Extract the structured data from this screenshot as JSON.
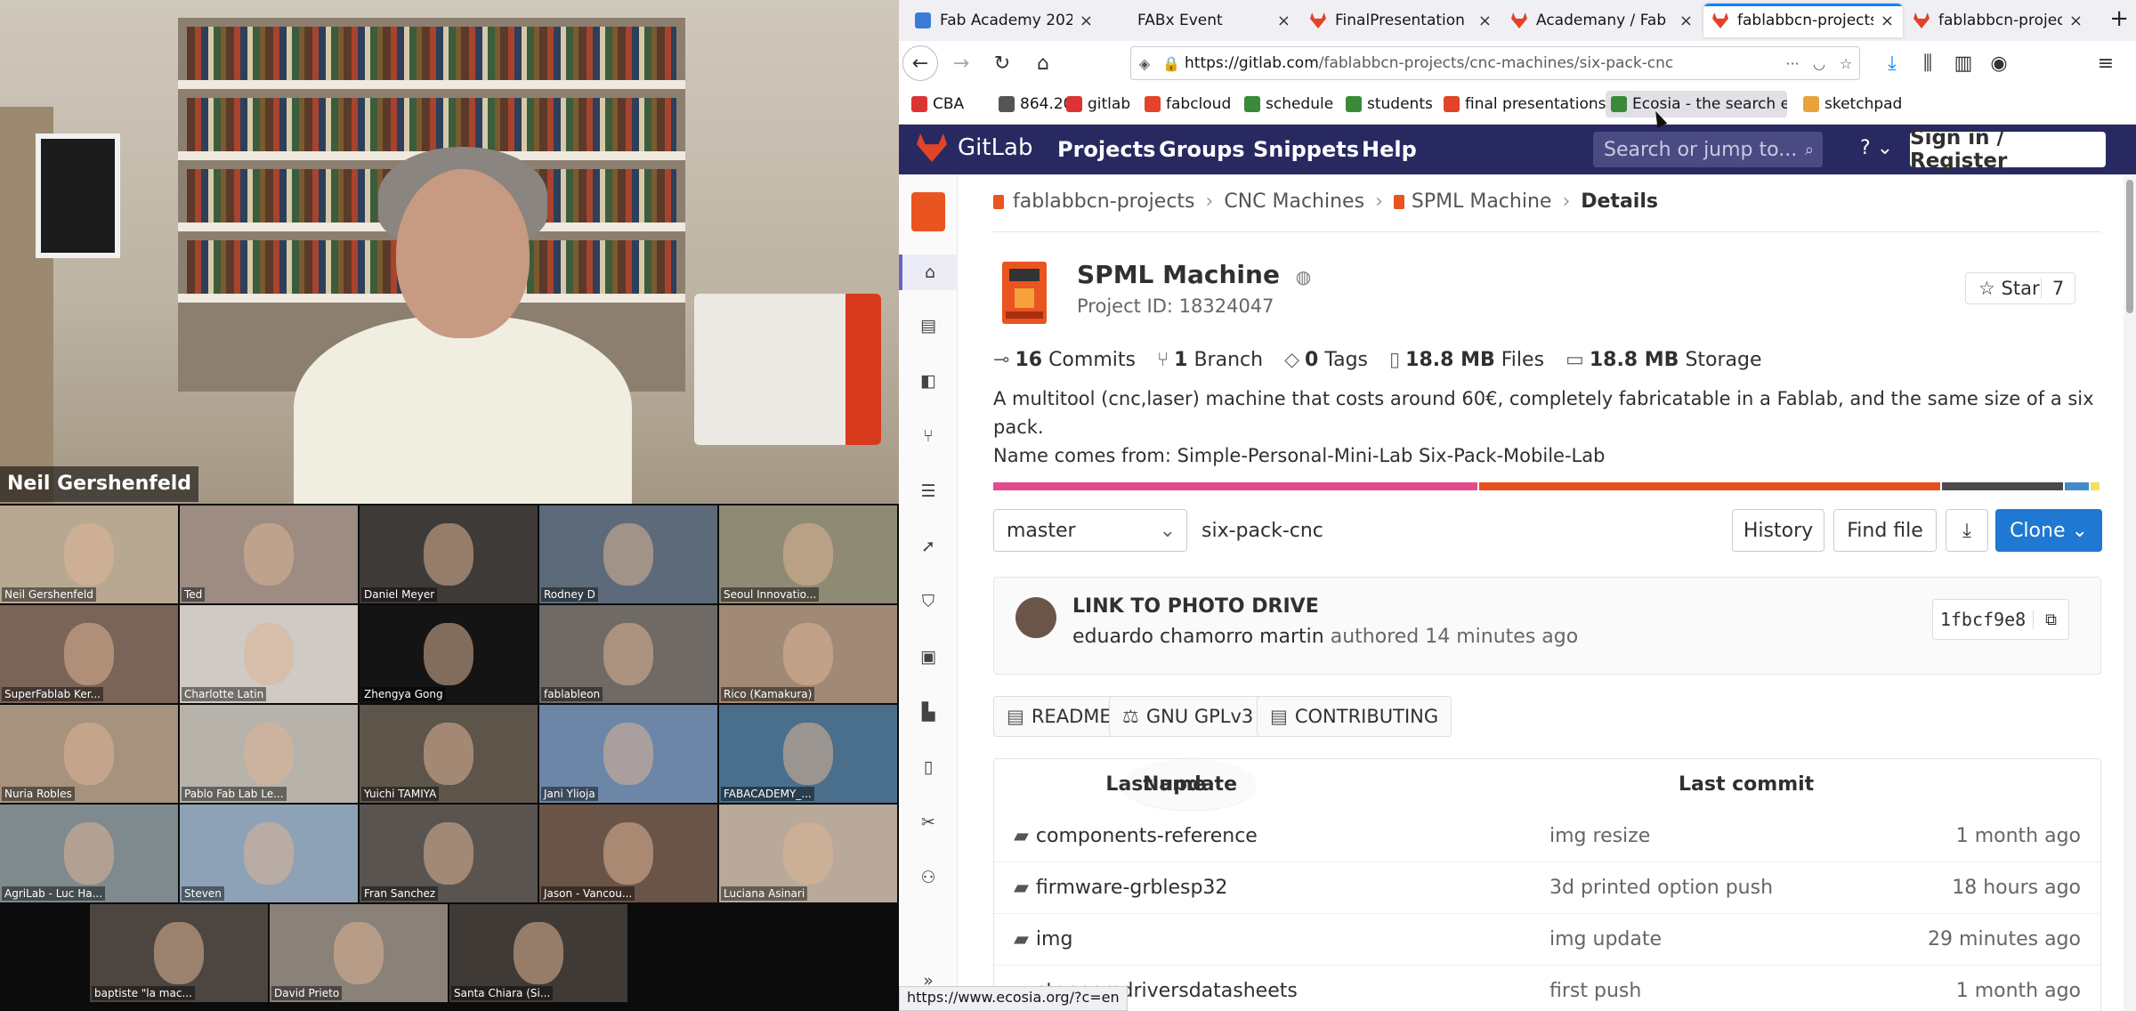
{
  "video": {
    "speaker_name": "Neil Gershenfeld",
    "tiles": [
      {
        "name": "Neil Gershenfeld",
        "color": "#b8a892"
      },
      {
        "name": "Ted",
        "color": "#9c8c82"
      },
      {
        "name": "Daniel Meyer",
        "color": "#3e3a37"
      },
      {
        "name": "Rodney D",
        "color": "#5c6a7a"
      },
      {
        "name": "Seoul Innovatio...",
        "color": "#8f8a73"
      },
      {
        "name": "SuperFablab Ker...",
        "color": "#7a6358"
      },
      {
        "name": "Charlotte Latin",
        "color": "#cfcbc4"
      },
      {
        "name": "Zhengya Gong",
        "color": "#141414"
      },
      {
        "name": "fablableon",
        "color": "#6f6a66"
      },
      {
        "name": "Rico (Kamakura)",
        "color": "#a08a76"
      },
      {
        "name": "Nuria Robles",
        "color": "#a7927e"
      },
      {
        "name": "Pablo Fab Lab Le...",
        "color": "#b7b2aa"
      },
      {
        "name": "Yuichi TAMIYA",
        "color": "#5d544a"
      },
      {
        "name": "Jani Ylioja",
        "color": "#6c86a8"
      },
      {
        "name": "FABACADEMY_...",
        "color": "#4a6f8c"
      },
      {
        "name": "AgriLab - Luc Ha...",
        "color": "#7f8a8f"
      },
      {
        "name": "Steven",
        "color": "#8da2b6"
      },
      {
        "name": "Fran Sanchez",
        "color": "#5a5450"
      },
      {
        "name": "Jason - Vancou...",
        "color": "#6a5448"
      },
      {
        "name": "Luciana Asinari",
        "color": "#b9a99a"
      },
      {
        "name": "baptiste \"la mac...",
        "color": "#4c4540"
      },
      {
        "name": "David Prieto",
        "color": "#8a8178"
      },
      {
        "name": "Santa Chiara (Si...",
        "color": "#403a36"
      }
    ]
  },
  "browser": {
    "tabs": [
      {
        "label": "Fab Academy 202",
        "fav_color": "#3a7bd5",
        "active": false
      },
      {
        "label": "FABx Event",
        "fav_color": "#f0f0f4",
        "active": false
      },
      {
        "label": "FinalPresentation",
        "fav_color": "#e24329",
        "active": false
      },
      {
        "label": "Academany / Fab",
        "fav_color": "#e24329",
        "active": false
      },
      {
        "label": "fablabbcn-projects",
        "fav_color": "#e24329",
        "active": true
      },
      {
        "label": "fablabbcn-projects",
        "fav_color": "#e24329",
        "active": false
      }
    ],
    "new_tab": "+",
    "url_host": "https://gitlab.com",
    "url_path": "/fablabbcn-projects/cnc-machines/six-pack-cnc",
    "bookmarks": [
      {
        "label": "CBA",
        "color": "#d33"
      },
      {
        "label": "864.20",
        "color": "#555"
      },
      {
        "label": "gitlab",
        "color": "#d33"
      },
      {
        "label": "fabcloud",
        "color": "#e24329"
      },
      {
        "label": "schedule",
        "color": "#3a8a3a"
      },
      {
        "label": "students",
        "color": "#3a8a3a"
      },
      {
        "label": "final presentations",
        "color": "#e24329"
      },
      {
        "label": "Ecosia - the search e...",
        "color": "#3a8a3a"
      },
      {
        "label": "sketchpad",
        "color": "#e8a33a"
      }
    ],
    "status_url": "https://www.ecosia.org/?c=en"
  },
  "gitlab": {
    "brand": "GitLab",
    "nav": [
      "Projects",
      "Groups",
      "Snippets",
      "Help"
    ],
    "search_placeholder": "Search or jump to...",
    "help_label": "?",
    "signin": "Sign in / Register",
    "breadcrumb": [
      "fablabbcn-projects",
      "CNC Machines",
      "SPML Machine",
      "Details"
    ],
    "project": {
      "name": "SPML Machine",
      "id_label": "Project ID: 18324047",
      "star_label": "Star",
      "star_count": "7",
      "stats": [
        {
          "value": "16",
          "label": "Commits"
        },
        {
          "value": "1",
          "label": "Branch"
        },
        {
          "value": "0",
          "label": "Tags"
        },
        {
          "value": "18.8 MB",
          "label": "Files"
        },
        {
          "value": "18.8 MB",
          "label": "Storage"
        }
      ],
      "description_1": "A multitool (cnc,laser) machine that costs around 60€, completely fabricatable in a Fablab, and the same size of a six pack.",
      "description_2": "Name comes from: Simple-Personal-Mini-Lab Six-Pack-Mobile-Lab",
      "languages": [
        {
          "color": "#e44b8d",
          "fraction": 0.487
        },
        {
          "color": "#e84e1e",
          "fraction": 0.463
        },
        {
          "color": "#4a4a4a",
          "fraction": 0.122
        },
        {
          "color": "#428bca",
          "fraction": 0.024
        },
        {
          "color": "#f1e05a",
          "fraction": 0.009
        }
      ]
    },
    "repo": {
      "branch": "master",
      "path": "six-pack-cnc",
      "history": "History",
      "find_file": "Find file",
      "download_icon": "⤓",
      "clone": "Clone"
    },
    "commit": {
      "title": "LINK TO PHOTO DRIVE",
      "author": "eduardo chamorro martin",
      "meta": "authored 14 minutes ago",
      "sha": "1fbcf9e8"
    },
    "pills": [
      "README",
      "GNU GPLv3",
      "CONTRIBUTING"
    ],
    "table": {
      "headers": [
        "Name",
        "Last commit",
        "Last update"
      ],
      "rows": [
        {
          "name": "components-reference",
          "commit": "img resize",
          "update": "1 month ago"
        },
        {
          "name": "firmware-grblesp32",
          "commit": "3d printed option push",
          "update": "18 hours ago"
        },
        {
          "name": "img",
          "commit": "img update",
          "update": "29 minutes ago"
        },
        {
          "name": "steppersdriversdatasheets",
          "commit": "first push",
          "update": "1 month ago"
        }
      ]
    }
  }
}
